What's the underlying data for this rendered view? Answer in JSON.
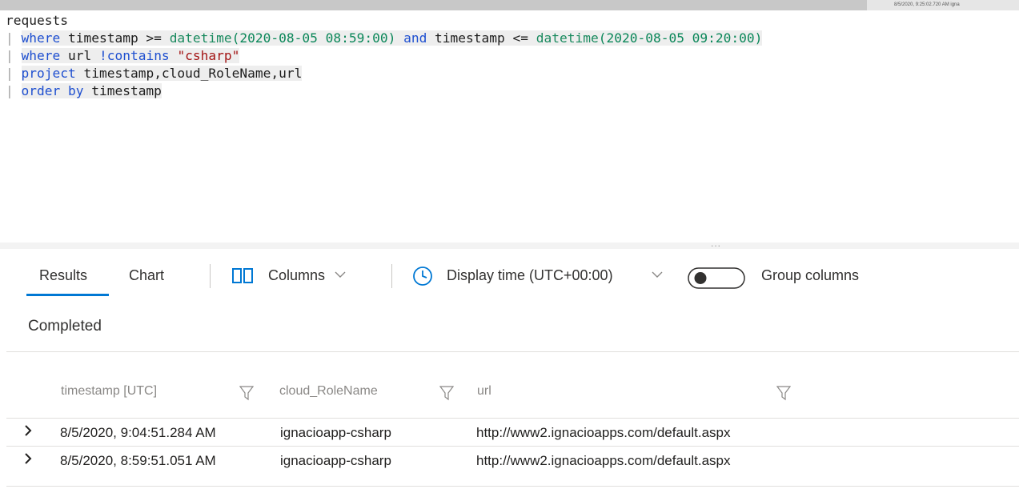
{
  "query": {
    "line1": "requests",
    "line2": {
      "bar": "|",
      "kw_where": "where",
      "mid1": " timestamp >= ",
      "fn1": "datetime",
      "arg1": "(2020-08-05 08:59:00)",
      "kw_and": " and",
      "mid2": " timestamp <= ",
      "fn2": "datetime",
      "arg2": "(2020-08-05 09:20:00)"
    },
    "line3": {
      "bar": "|",
      "kw_where": "where",
      "mid": " url ",
      "op": "!contains",
      "sp": " ",
      "str": "\"csharp\""
    },
    "line4": {
      "bar": "|",
      "kw": "project",
      "rest": " timestamp,cloud_RoleName,url"
    },
    "line5": {
      "bar": "|",
      "kw": "order by",
      "rest": " timestamp"
    }
  },
  "splitter_dots": "...",
  "toolbar": {
    "tab_results": "Results",
    "tab_chart": "Chart",
    "columns_label": "Columns",
    "display_time_label": "Display time (UTC+00:00)",
    "group_columns_label": "Group columns",
    "group_columns_on": false
  },
  "status": "Completed",
  "table": {
    "headers": [
      "timestamp [UTC]",
      "cloud_RoleName",
      "url"
    ],
    "rows": [
      [
        "8/5/2020, 9:04:51.284 AM",
        "ignacioapp-csharp",
        "http://www2.ignacioapps.com/default.aspx"
      ],
      [
        "8/5/2020, 8:59:51.051 AM",
        "ignacioapp-csharp",
        "http://www2.ignacioapps.com/default.aspx"
      ]
    ]
  },
  "top_thumb_text": "8/5/2020, 9:25:02.720 AM   igna",
  "colors": {
    "accent": "#0078d4",
    "keyword": "#1e4fd0",
    "string": "#a31515",
    "datetime_arg": "#098658"
  }
}
